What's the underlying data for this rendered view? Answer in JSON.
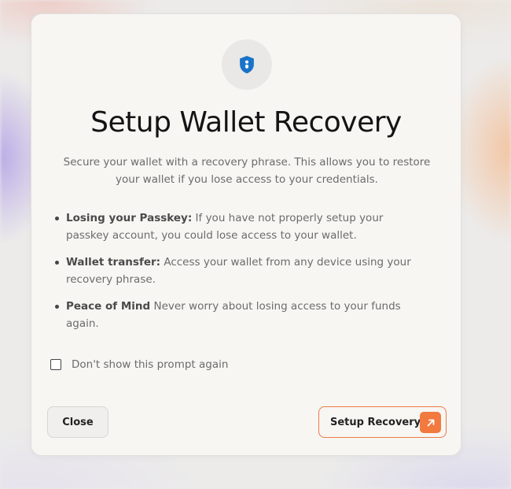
{
  "modal": {
    "title": "Setup Wallet Recovery",
    "subtitle": "Secure your wallet with a recovery phrase. This allows you to restore your wallet if you lose access to your credentials.",
    "icon": "shield-icon",
    "features": [
      {
        "heading": "Losing your Passkey:",
        "text": " If you have not properly setup your passkey account, you could lose access to your wallet."
      },
      {
        "heading": "Wallet transfer:",
        "text": " Access your wallet from any device using your recovery phrase."
      },
      {
        "heading": "Peace of Mind",
        "text": " Never worry about losing access to your funds again."
      }
    ],
    "checkbox": {
      "label": "Don't show this prompt again",
      "checked": false
    },
    "close_label": "Close",
    "setup_label": "Setup Recovery",
    "setup_icon": "arrow-up-right-icon"
  },
  "colors": {
    "accent": "#f27a3f",
    "shield": "#1a73c8",
    "title": "#141414",
    "body_text": "#6b6b6b"
  }
}
